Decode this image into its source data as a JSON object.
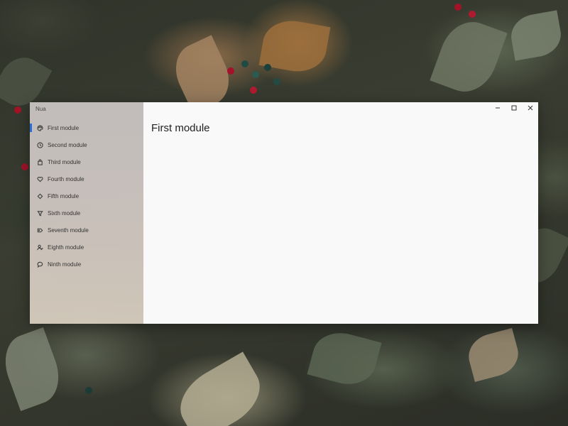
{
  "window": {
    "app_title": "Nua",
    "page_title": "First module"
  },
  "sidebar": {
    "items": [
      {
        "label": "First module",
        "icon": "palette-icon",
        "selected": true
      },
      {
        "label": "Second module",
        "icon": "clock-icon",
        "selected": false
      },
      {
        "label": "Third module",
        "icon": "bag-icon",
        "selected": false
      },
      {
        "label": "Fourth module",
        "icon": "heart-icon",
        "selected": false
      },
      {
        "label": "Fifth module",
        "icon": "diamond-icon",
        "selected": false
      },
      {
        "label": "Sixth module",
        "icon": "filter-icon",
        "selected": false
      },
      {
        "label": "Seventh module",
        "icon": "tag-icon",
        "selected": false
      },
      {
        "label": "Eighth module",
        "icon": "person-icon",
        "selected": false
      },
      {
        "label": "Ninth module",
        "icon": "chat-icon",
        "selected": false
      }
    ]
  },
  "colors": {
    "accent": "#2b6cd8",
    "content_bg": "#f9f9f9"
  }
}
